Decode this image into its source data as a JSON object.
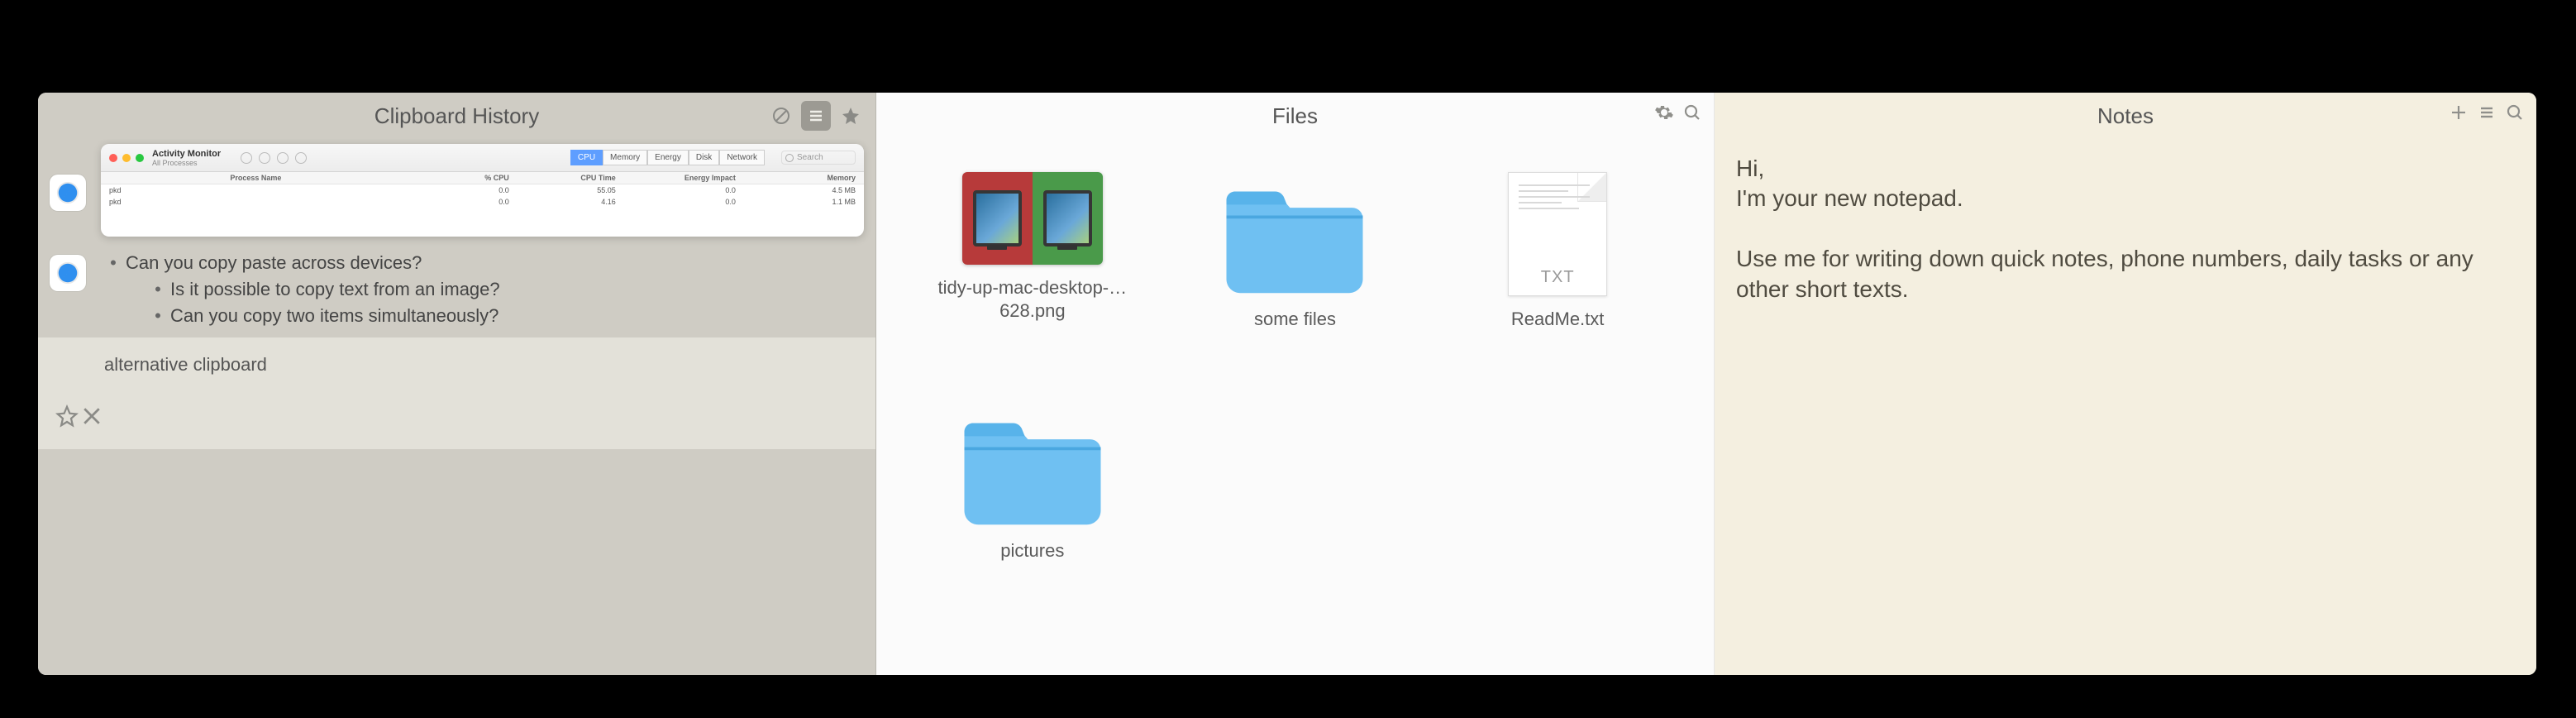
{
  "clipboard": {
    "title": "Clipboard History",
    "items": [
      {
        "type": "screenshot",
        "app": "safari",
        "activity_monitor": {
          "title": "Activity Monitor",
          "subtitle": "All Processes",
          "tabs": [
            "CPU",
            "Memory",
            "Energy",
            "Disk",
            "Network"
          ],
          "search_placeholder": "Search",
          "columns": [
            "Process Name",
            "% CPU",
            "CPU Time",
            "Energy Impact",
            "Memory"
          ],
          "rows": [
            {
              "name": "pkd",
              "cpu": "0.0",
              "cputime": "55.05",
              "energy": "0.0",
              "mem": "4.5 MB"
            },
            {
              "name": "pkd",
              "cpu": "0.0",
              "cputime": "4.16",
              "energy": "0.0",
              "mem": "1.1 MB"
            }
          ]
        }
      },
      {
        "type": "text",
        "app": "safari",
        "lines": [
          "Can you copy paste across devices?",
          "Is it possible to copy text from an image?",
          "Can you copy two items simultaneously?"
        ]
      },
      {
        "type": "text",
        "selected": true,
        "text": "alternative clipboard"
      }
    ]
  },
  "files": {
    "title": "Files",
    "items": [
      {
        "kind": "image",
        "name": "tidy-up-mac-desktop-…628.png"
      },
      {
        "kind": "folder",
        "name": "some files"
      },
      {
        "kind": "txt",
        "name": "ReadMe.txt",
        "ext": "TXT"
      },
      {
        "kind": "folder",
        "name": "pictures"
      }
    ]
  },
  "notes": {
    "title": "Notes",
    "body": "Hi,\nI'm your new notepad.\n\nUse me for writing down quick notes, phone numbers, daily tasks or any other short texts."
  }
}
